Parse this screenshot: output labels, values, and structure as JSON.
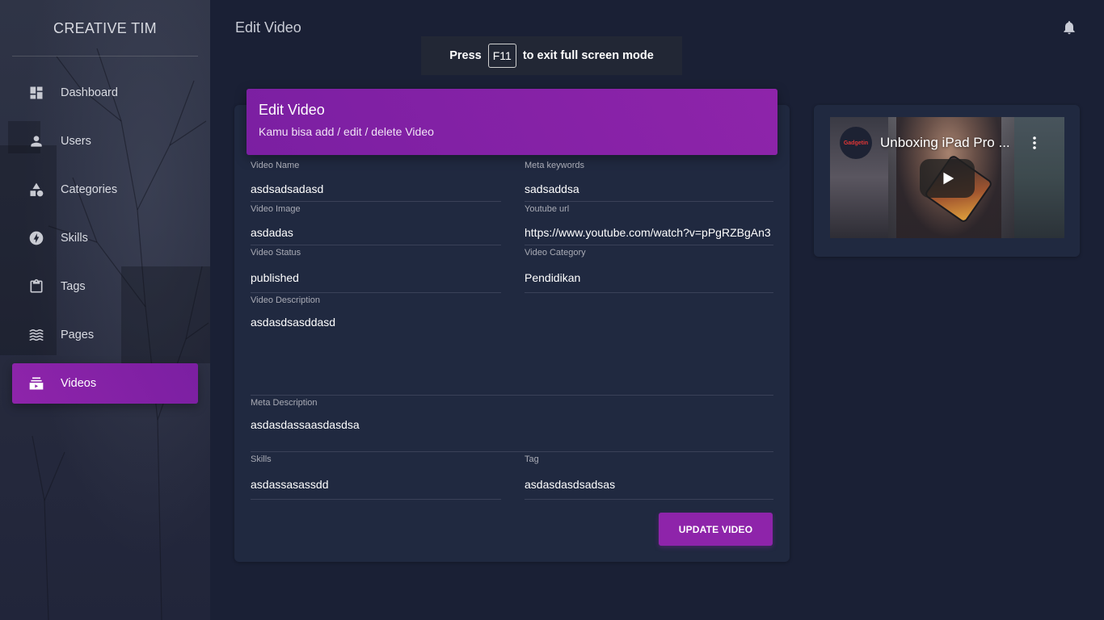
{
  "brand": {
    "title": "CREATIVE TIM"
  },
  "sidebar": {
    "items": [
      {
        "label": "Dashboard",
        "icon": "dashboard-icon",
        "active": false
      },
      {
        "label": "Users",
        "icon": "person-icon",
        "active": false
      },
      {
        "label": "Categories",
        "icon": "category-icon",
        "active": false
      },
      {
        "label": "Skills",
        "icon": "bolt-icon",
        "active": false
      },
      {
        "label": "Tags",
        "icon": "clipboard-icon",
        "active": false
      },
      {
        "label": "Pages",
        "icon": "waves-icon",
        "active": false
      },
      {
        "label": "Videos",
        "icon": "video-library-icon",
        "active": true
      }
    ]
  },
  "header": {
    "page_title": "Edit Video"
  },
  "fullscreen_notice": {
    "press": "Press",
    "key": "F11",
    "message": "to exit full screen mode"
  },
  "card": {
    "title": "Edit Video",
    "subtitle": "Kamu bisa add / edit / delete Video"
  },
  "form": {
    "video_name": {
      "label": "Video Name",
      "value": "asdsadsadasd"
    },
    "meta_keywords": {
      "label": "Meta keywords",
      "value": "sadsaddsa"
    },
    "video_image": {
      "label": "Video Image",
      "value": "asdadas"
    },
    "youtube_url": {
      "label": "Youtube url",
      "value": "https://www.youtube.com/watch?v=pPgRZBgAn3"
    },
    "video_status": {
      "label": "Video Status",
      "value": "published"
    },
    "video_category": {
      "label": "Video Category",
      "value": "Pendidikan"
    },
    "video_description": {
      "label": "Video Description",
      "value": "asdasdsasddasd"
    },
    "meta_description": {
      "label": "Meta Description",
      "value": "asdasdassaasdasdsa"
    },
    "skills": {
      "label": "Skills",
      "value": "asdassasassdd"
    },
    "tag": {
      "label": "Tag",
      "value": "asdasdasdsadsas"
    }
  },
  "actions": {
    "update_label": "UPDATE VIDEO"
  },
  "video_preview": {
    "title": "Unboxing iPad Pro ...",
    "channel_logo_text": "Gadgetin"
  },
  "colors": {
    "background": "#1a2035",
    "card": "#202940",
    "accent": "#8e24aa"
  }
}
